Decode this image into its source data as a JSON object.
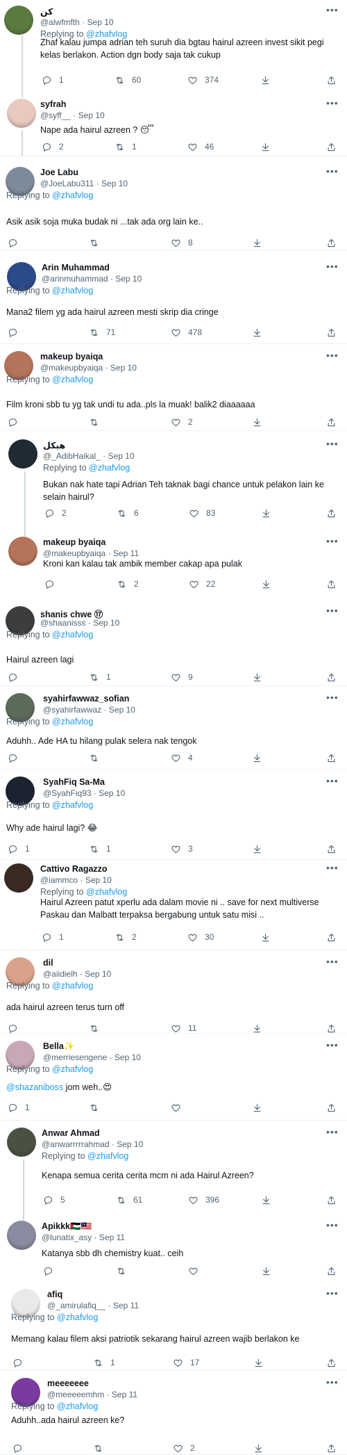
{
  "replying_label": "Replying to",
  "tweets": [
    {
      "name": "كن",
      "handle": "@alwfmfth",
      "date": "Sep 10",
      "replying_to": "@zhafvlog",
      "text": "Zhaf kalau jumpa adrian teh suruh dia bgtau hairul azreen invest sikit pegi kelas berlakon. Action dgn body saja tak cukup",
      "replies": "1",
      "retweets": "60",
      "likes": "374",
      "avatar_color": "#5b7a3e"
    },
    {
      "name": "syfrah",
      "handle": "@syff__",
      "date": "Sep 10",
      "replying_to": "",
      "text": "Nape ada hairul azreen ? 😴",
      "replies": "2",
      "retweets": "1",
      "likes": "46",
      "avatar_color": "#e8c9c0"
    },
    {
      "name": "Joe Labu",
      "handle": "@JoeLabu311",
      "date": "Sep 10",
      "replying_to": "@zhafvlog",
      "text": "Asik asik soja muka budak ni ...tak ada org lain ke..",
      "replies": "",
      "retweets": "",
      "likes": "8",
      "avatar_color": "#7d8a99"
    },
    {
      "name": "Arin Muhammad",
      "handle": "@arinmuhammad",
      "date": "Sep 10",
      "replying_to": "@zhafvlog",
      "text": "Mana2 filem yg ada hairul azreen mesti skrip dia cringe",
      "replies": "",
      "retweets": "71",
      "likes": "478",
      "avatar_color": "#2b4a8a"
    },
    {
      "name": "makeup byaiqa",
      "handle": "@makeupbyaiqa",
      "date": "Sep 10",
      "replying_to": "@zhafvlog",
      "text": "Film kroni sbb tu yg tak undi tu ada..pls la muak! balik2 diaaaaaa",
      "replies": "",
      "retweets": "",
      "likes": "2",
      "avatar_color": "#b5735a"
    },
    {
      "name": "هيكل",
      "handle": "@_AdibHaikal_",
      "date": "Sep 10",
      "replying_to": "@zhafvlog",
      "text": "Bukan nak hate tapi Adrian Teh taknak bagi chance untuk pelakon lain ke selain hairul?",
      "replies": "2",
      "retweets": "6",
      "likes": "83",
      "avatar_color": "#1f2a33"
    },
    {
      "name": "makeup byaiqa",
      "handle": "@makeupbyaiqa",
      "date": "Sep 11",
      "replying_to": "",
      "text": "Kroni kan kalau tak ambik member cakap apa pulak",
      "replies": "",
      "retweets": "2",
      "likes": "22",
      "avatar_color": "#b5735a"
    },
    {
      "name": "shanis chwe ⑰",
      "handle": "@shaanisss",
      "date": "Sep 10",
      "replying_to": "@zhafvlog",
      "text": "Hairul azreen lagi",
      "replies": "",
      "retweets": "1",
      "likes": "9",
      "avatar_color": "#3d3d3d"
    },
    {
      "name": "syahirfawwaz_sofian",
      "handle": "@syahirfawwaz",
      "date": "Sep 10",
      "replying_to": "@zhafvlog",
      "text": "Aduhh.. Ade HA tu hilang pulak selera nak tengok",
      "replies": "",
      "retweets": "",
      "likes": "4",
      "avatar_color": "#5c6b5a"
    },
    {
      "name": "SyahFiq Sa-Ma",
      "handle": "@SyahFiq93",
      "date": "Sep 10",
      "replying_to": "@zhafvlog",
      "text": "Why ade hairul lagi? 😂",
      "replies": "1",
      "retweets": "1",
      "likes": "3",
      "avatar_color": "#1c2230"
    },
    {
      "name": "Cattivo Ragazzo",
      "handle": "@iammco",
      "date": "Sep 10",
      "replying_to": "@zhafvlog",
      "text": "Hairul Azreen patut xperlu ada dalam movie ni .. save for next multiverse Paskau dan Malbatt terpaksa bergabung untuk satu misi ..",
      "replies": "1",
      "retweets": "2",
      "likes": "30",
      "avatar_color": "#3a2a22"
    },
    {
      "name": "dil",
      "handle": "@aiidielh",
      "date": "Sep 10",
      "replying_to": "@zhafvlog",
      "text": "ada hairul azreen terus turn off",
      "replies": "",
      "retweets": "",
      "likes": "11",
      "avatar_color": "#d9a38a"
    },
    {
      "name": "Bella✨",
      "handle": "@merriesengene",
      "date": "Sep 10",
      "replying_to": "@zhafvlog",
      "mention": "@shazaniboss",
      "text": " jom weh..😍",
      "replies": "1",
      "retweets": "",
      "likes": "",
      "avatar_color": "#c8a8b8"
    },
    {
      "name": "Anwar Ahmad",
      "handle": "@anwarrrrrahmad",
      "date": "Sep 10",
      "replying_to": "@zhafvlog",
      "text": "Kenapa semua cerita cerita mcm ni ada Hairul Azreen?",
      "replies": "5",
      "retweets": "61",
      "likes": "396",
      "avatar_color": "#4a5140"
    },
    {
      "name": "Apikkk🇵🇸🇲🇾",
      "handle": "@lunatix_asy",
      "date": "Sep 11",
      "replying_to": "",
      "text": "Katanya sbb dh chemistry kuat.. ceih",
      "replies": "",
      "retweets": "",
      "likes": "",
      "avatar_color": "#8a8aa0"
    },
    {
      "name": "afiq",
      "handle": "@_amirulafiq__",
      "date": "Sep 11",
      "replying_to": "@zhafvlog",
      "text": "Memang kalau filem aksi patriotik sekarang hairul azreen wajib berlakon ke",
      "replies": "",
      "retweets": "1",
      "likes": "17",
      "avatar_color": "#e9e9e9"
    },
    {
      "name": "meeeeeee",
      "handle": "@meeeeemhm",
      "date": "Sep 11",
      "replying_to": "@zhafvlog",
      "text": "Aduhh..ada hairul azreen ke?",
      "replies": "",
      "retweets": "",
      "likes": "2",
      "avatar_color": "#7a3aa0"
    }
  ]
}
